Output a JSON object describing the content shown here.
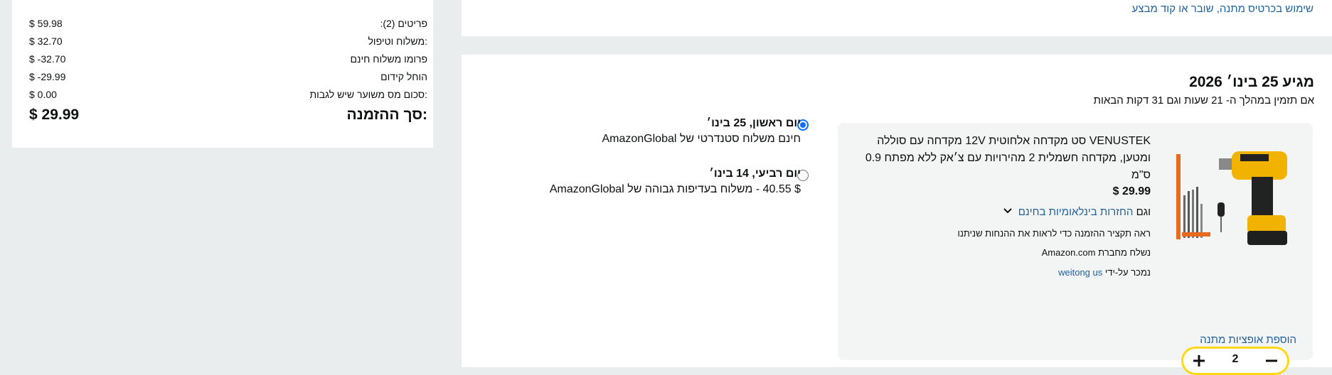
{
  "summary": {
    "items_label": "פריטים (2):",
    "items_value": "$ 59.98",
    "shipping_label": ":משלוח וטיפול",
    "shipping_value": "$ 32.70",
    "promo_shipping_label": "פרומו משלוח חינם",
    "promo_shipping_value": "$ -32.70",
    "promo_applied_label": "הוחל קידום",
    "promo_applied_value": "$ -29.99",
    "tax_label": ":סכום מס משוער שיש לגבות",
    "tax_value": "$ 0.00",
    "total_label": ":סך ההזמנה",
    "total_value": "$ 29.99"
  },
  "gift_card_link": "שימוש בכרטיס מתנה, שובר או קוד מבצע",
  "delivery": {
    "arrive_title": "מגיע 25 בינו׳ 2026",
    "cutoff_text": "אם תזמין במהלך ה-  21 שעות וגם 31 דקות הבאות"
  },
  "item": {
    "title": "VENUSTEK סט מקדחה אלחוטית 12V מקדחה עם סוללה ומטען, מקדחה חשמלית 2 מהירויות עם צ׳אק ללא מפתח 0.9 ס\"מ",
    "price": "$ 29.99",
    "returns_prefix": "וגם",
    "returns_link": "החזרות בינלאומיות בחינם",
    "order_summary_note": "ראה תקציר ההזמנה כדי לראות את ההנחות שניתנו",
    "shipped_from": "נשלח מחברת Amazon.com",
    "sold_by_prefix": "נמכר על-ידי",
    "sold_by_link": "weitong us",
    "quantity": "2",
    "gift_options": "הוספת אופציות מתנה"
  },
  "shipping_options": [
    {
      "title": "יום ראשון, 25 בינו׳",
      "desc": "חינם משלוח סטנדרטי של AmazonGlobal",
      "selected": true
    },
    {
      "title": "יום רביעי, 14 בינו׳",
      "desc": "$ 40.55 - משלוח בעדיפות גבוהה של AmazonGlobal",
      "selected": false
    }
  ],
  "colors": {
    "link": "#2162a1",
    "accent_yellow": "#ffd814",
    "radio_blue": "#0d6efd",
    "page_bg": "#eaeded"
  },
  "icons": {
    "plus": "plus-icon",
    "minus": "minus-icon",
    "chevron": "chevron-down-icon",
    "radio": "radio-button"
  }
}
